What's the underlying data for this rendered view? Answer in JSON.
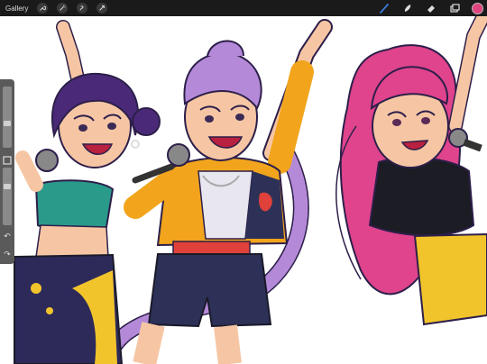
{
  "toolbar": {
    "gallery_label": "Gallery",
    "left_tools": [
      "wrench-icon",
      "magic-wand-icon",
      "selection-icon",
      "transform-arrow-icon"
    ],
    "right_tools": [
      "brush-icon",
      "smudge-icon",
      "eraser-icon",
      "layers-icon"
    ],
    "current_color": "#e0447f",
    "active_color": "#3b7ddd"
  },
  "sidebar": {
    "size_slider_level": 0.7,
    "opacity_slider_level": 0.35,
    "undo_icon": "undo-icon",
    "redo_icon": "redo-icon"
  },
  "colors": {
    "purple_hair": "#4a2a78",
    "lilac_hair": "#b48ad8",
    "pink_hair": "#e0448c",
    "jacket_yellow": "#f2a51c",
    "skin": "#f6c6a4",
    "navy": "#2d3157",
    "red": "#e0413b",
    "teal": "#2a9a8a",
    "yellow_skirt": "#f2c42c"
  }
}
